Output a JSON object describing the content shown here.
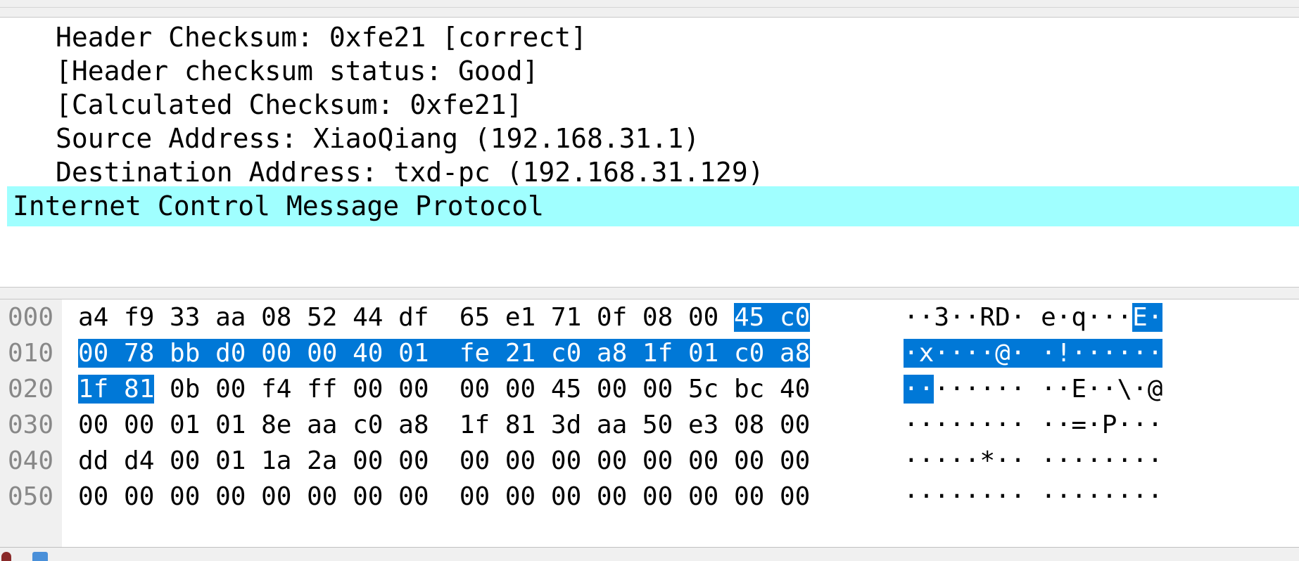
{
  "packet_details": {
    "lines": [
      "Header Checksum: 0xfe21 [correct]",
      "[Header checksum status: Good]",
      "[Calculated Checksum: 0xfe21]",
      "Source Address: XiaoQiang (192.168.31.1)",
      "Destination Address: txd-pc (192.168.31.129)"
    ],
    "selected_line": "Internet Control Message Protocol",
    "selected_color": "#a0ffff"
  },
  "packet_bytes": {
    "highlight_color": "#0078d7",
    "rows": [
      {
        "offset": "000",
        "hex_a": "a4 f9 33 aa 08 52 44 df  65 e1 71 0f 08 00 ",
        "hex_hl": "45 c0",
        "hex_b": "",
        "ascii_a": "··3··RD· e·q···",
        "ascii_hl": "E·",
        "ascii_b": ""
      },
      {
        "offset": "010",
        "hex_a": "",
        "hex_hl": "00 78 bb d0 00 00 40 01  fe 21 c0 a8 1f 01 c0 a8",
        "hex_b": "",
        "ascii_a": "",
        "ascii_hl": "·x····@· ·!······",
        "ascii_b": ""
      },
      {
        "offset": "020",
        "hex_a": "",
        "hex_hl": "1f 81",
        "hex_b": " 0b 00 f4 ff 00 00  00 00 45 00 00 5c bc 40",
        "ascii_a": "",
        "ascii_hl": "··",
        "ascii_b": "······ ··E··\\·@"
      },
      {
        "offset": "030",
        "hex_a": "00 00 01 01 8e aa c0 a8  1f 81 3d aa 50 e3 08 00",
        "hex_hl": "",
        "hex_b": "",
        "ascii_a": "········ ··=·P···",
        "ascii_hl": "",
        "ascii_b": ""
      },
      {
        "offset": "040",
        "hex_a": "dd d4 00 01 1a 2a 00 00  00 00 00 00 00 00 00 00",
        "hex_hl": "",
        "hex_b": "",
        "ascii_a": "·····*·· ········",
        "ascii_hl": "",
        "ascii_b": ""
      },
      {
        "offset": "050",
        "hex_a": "00 00 00 00 00 00 00 00  00 00 00 00 00 00 00 00",
        "hex_hl": "",
        "hex_b": "",
        "ascii_a": "········ ········",
        "ascii_hl": "",
        "ascii_b": ""
      }
    ]
  }
}
